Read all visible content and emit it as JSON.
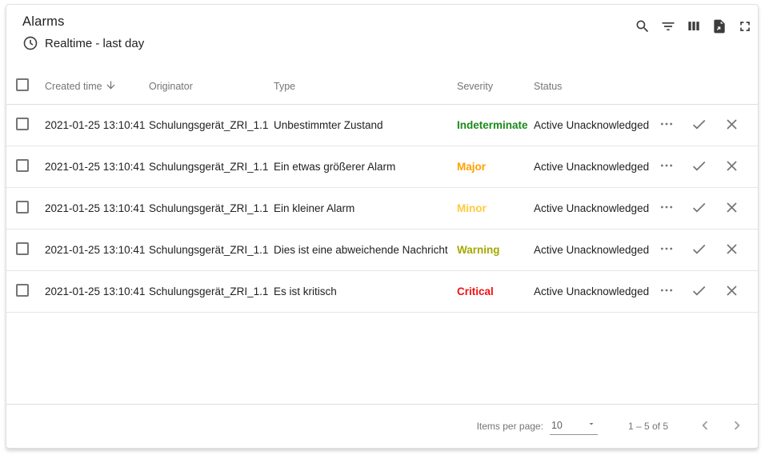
{
  "widget": {
    "title": "Alarms",
    "subtitle": "Realtime - last day",
    "subtitle_icon": "clock-icon",
    "header_action_icons": [
      "search",
      "filter-list",
      "view-columns",
      "export-file",
      "fullscreen"
    ]
  },
  "table": {
    "columns": [
      "Created time",
      "Originator",
      "Type",
      "Severity",
      "Status"
    ],
    "sort": {
      "column": "Created time",
      "direction": "desc"
    },
    "row_action_icons": [
      "more-horizontal",
      "check",
      "close"
    ],
    "rows": [
      {
        "created": "2021-01-25 13:10:41",
        "originator": "Schulungsgerät_ZRI_1.1",
        "type": "Unbestimmter Zustand",
        "severity": "Indeterminate",
        "severity_color": "#1b8a1b",
        "status": "Active Unacknowledged"
      },
      {
        "created": "2021-01-25 13:10:41",
        "originator": "Schulungsgerät_ZRI_1.1",
        "type": "Ein etwas größerer Alarm",
        "severity": "Major",
        "severity_color": "#ffa000",
        "status": "Active Unacknowledged"
      },
      {
        "created": "2021-01-25 13:10:41",
        "originator": "Schulungsgerät_ZRI_1.1",
        "type": "Ein kleiner Alarm",
        "severity": "Minor",
        "severity_color": "#ffca3d",
        "status": "Active Unacknowledged"
      },
      {
        "created": "2021-01-25 13:10:41",
        "originator": "Schulungsgerät_ZRI_1.1",
        "type": "Dies ist eine abweichende Nachricht",
        "severity": "Warning",
        "severity_color": "#a2a900",
        "status": "Active Unacknowledged"
      },
      {
        "created": "2021-01-25 13:10:41",
        "originator": "Schulungsgerät_ZRI_1.1",
        "type": "Es ist kritisch",
        "severity": "Critical",
        "severity_color": "#f01212",
        "status": "Active Unacknowledged"
      }
    ]
  },
  "paginator": {
    "items_per_page_label": "Items per page:",
    "page_size": "10",
    "range_label": "1 – 5 of 5"
  },
  "colors": {
    "card_border": "#e0e0e0",
    "header_icon": "#3c3c3c",
    "muted_text": "#757575",
    "cell_text": "#212121"
  }
}
